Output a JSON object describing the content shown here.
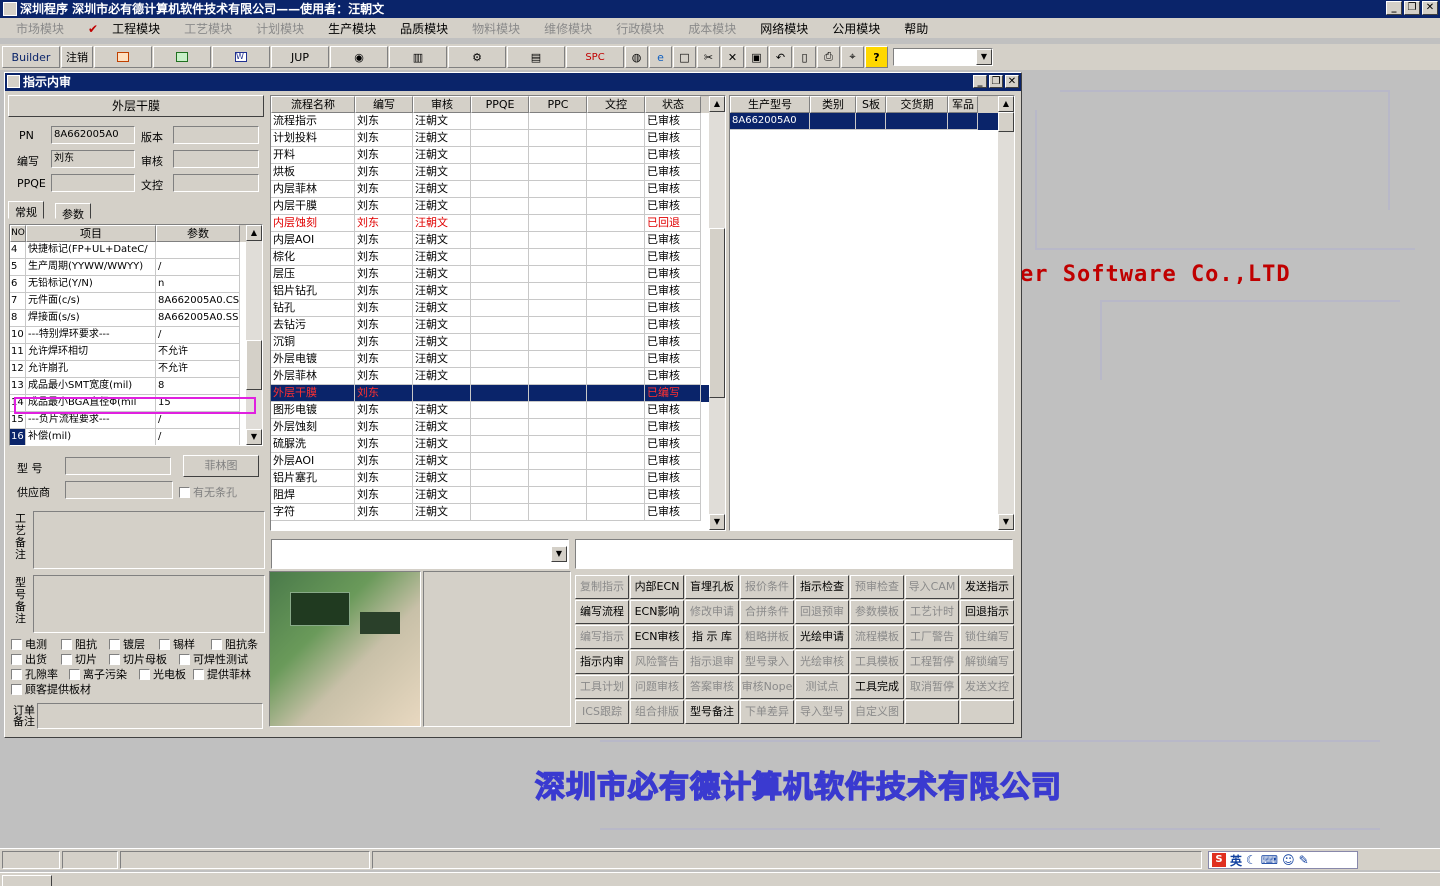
{
  "app_title": "深圳程序  深圳市必有德计算机软件技术有限公司——使用者：汪朝文",
  "window_buttons": [
    "_",
    "❐",
    "✕"
  ],
  "menu": [
    {
      "label": "市场模块",
      "enabled": false
    },
    {
      "label": "工程模块",
      "enabled": true,
      "checked": true
    },
    {
      "label": "工艺模块",
      "enabled": false
    },
    {
      "label": "计划模块",
      "enabled": false
    },
    {
      "label": "生产模块",
      "enabled": true
    },
    {
      "label": "品质模块",
      "enabled": true
    },
    {
      "label": "物料模块",
      "enabled": false
    },
    {
      "label": "维修模块",
      "enabled": false
    },
    {
      "label": "行政模块",
      "enabled": false
    },
    {
      "label": "成本模块",
      "enabled": false
    },
    {
      "label": "网络模块",
      "enabled": true
    },
    {
      "label": "公用模块",
      "enabled": true
    },
    {
      "label": "帮助",
      "enabled": true
    }
  ],
  "toolbar": {
    "builder": "Builder",
    "logout": "注销",
    "jup": "JUP",
    "spc": "SPC"
  },
  "toolbar_icons": [
    "excel-icon",
    "excel2-icon",
    "word-icon",
    "eye-icon",
    "database-icon",
    "gear-icon",
    "scanner-icon",
    "globe-icon",
    "ie-icon",
    "new-doc-icon",
    "cut-icon",
    "delete-icon",
    "save-icon",
    "undo-icon",
    "preview-icon",
    "print-icon",
    "binoculars-icon",
    "help-icon"
  ],
  "bg_text": "er Software Co.,LTD",
  "bg_banner": "深圳市必有德计算机软件技术有限公司",
  "child": {
    "title": "指示内审",
    "layer_label": "外层干膜",
    "pn_label": "PN",
    "pn_value": "8A662005A0",
    "version_label": "版本",
    "version_value": "",
    "writer_label": "编写",
    "writer_value": "刘东",
    "audit_label": "审核",
    "audit_value": "",
    "ppqe_label": "PPQE",
    "ppqe_value": "",
    "doc_label": "文控",
    "doc_value": "",
    "tabs": [
      "常规",
      "参数"
    ],
    "param_headers": [
      "NO",
      "项目",
      "参数"
    ],
    "params": [
      {
        "no": "4",
        "item": "快捷标记(FP+UL+DateC/",
        "value": ""
      },
      {
        "no": "5",
        "item": "生产周期(YYWW/WWYY)",
        "value": "/"
      },
      {
        "no": "6",
        "item": "无铅标记(Y/N)",
        "value": "n"
      },
      {
        "no": "7",
        "item": "元件面(c/s)",
        "value": "8A662005A0.CS"
      },
      {
        "no": "8",
        "item": "焊接面(s/s)",
        "value": "8A662005A0.SS"
      },
      {
        "no": "10",
        "item": "---特别焊环要求---",
        "value": "/"
      },
      {
        "no": "11",
        "item": "允许焊环相切",
        "value": "不允许"
      },
      {
        "no": "12",
        "item": "允许崩孔",
        "value": "不允许"
      },
      {
        "no": "13",
        "item": "成品最小SMT宽度(mil)",
        "value": "8"
      },
      {
        "no": "14",
        "item": "成品最小BGA直径Φ(mil",
        "value": "15"
      },
      {
        "no": "15",
        "item": "---负片流程要求---",
        "value": "/"
      },
      {
        "no": "16",
        "item": "补偿(mil)",
        "value": "/"
      }
    ],
    "model_label": "型  号",
    "model_value": "",
    "film_button": "菲林图",
    "supplier_label": "供应商",
    "supplier_value": "",
    "no_strip_label": "有无条孔",
    "process_note_label": "工艺备注",
    "model_note_label": "型号备注",
    "order_note_label": "订单备注",
    "checkboxes": [
      [
        "电测",
        "阻抗",
        "镀层",
        "锡样",
        "阻抗条"
      ],
      [
        "出货",
        "切片",
        "切片母板",
        "可焊性测试"
      ],
      [
        "孔隙率",
        "离子污染",
        "光电板",
        "提供菲林"
      ],
      [
        "顾客提供板材"
      ]
    ],
    "flow_headers": [
      "流程名称",
      "编写",
      "审核",
      "PPQE",
      "PPC",
      "文控",
      "状态"
    ],
    "flows": [
      {
        "name": "流程指示",
        "writer": "刘东",
        "auditor": "汪朝文",
        "status": "已审核"
      },
      {
        "name": "计划投料",
        "writer": "刘东",
        "auditor": "汪朝文",
        "status": "已审核"
      },
      {
        "name": "开料",
        "writer": "刘东",
        "auditor": "汪朝文",
        "status": "已审核"
      },
      {
        "name": "烘板",
        "writer": "刘东",
        "auditor": "汪朝文",
        "status": "已审核"
      },
      {
        "name": "内层菲林",
        "writer": "刘东",
        "auditor": "汪朝文",
        "status": "已审核"
      },
      {
        "name": "内层干膜",
        "writer": "刘东",
        "auditor": "汪朝文",
        "status": "已审核"
      },
      {
        "name": "内层蚀刻",
        "writer": "刘东",
        "auditor": "汪朝文",
        "status": "已回退"
      },
      {
        "name": "内层AOI",
        "writer": "刘东",
        "auditor": "汪朝文",
        "status": "已审核"
      },
      {
        "name": "棕化",
        "writer": "刘东",
        "auditor": "汪朝文",
        "status": "已审核"
      },
      {
        "name": "层压",
        "writer": "刘东",
        "auditor": "汪朝文",
        "status": "已审核"
      },
      {
        "name": "铝片钻孔",
        "writer": "刘东",
        "auditor": "汪朝文",
        "status": "已审核"
      },
      {
        "name": "钻孔",
        "writer": "刘东",
        "auditor": "汪朝文",
        "status": "已审核"
      },
      {
        "name": "去钻污",
        "writer": "刘东",
        "auditor": "汪朝文",
        "status": "已审核"
      },
      {
        "name": "沉铜",
        "writer": "刘东",
        "auditor": "汪朝文",
        "status": "已审核"
      },
      {
        "name": "外层电镀",
        "writer": "刘东",
        "auditor": "汪朝文",
        "status": "已审核"
      },
      {
        "name": "外层菲林",
        "writer": "刘东",
        "auditor": "汪朝文",
        "status": "已审核"
      },
      {
        "name": "外层干膜",
        "writer": "刘东",
        "auditor": "",
        "status": "已编写"
      },
      {
        "name": "图形电镀",
        "writer": "刘东",
        "auditor": "汪朝文",
        "status": "已审核"
      },
      {
        "name": "外层蚀刻",
        "writer": "刘东",
        "auditor": "汪朝文",
        "status": "已审核"
      },
      {
        "name": "硫脲洗",
        "writer": "刘东",
        "auditor": "汪朝文",
        "status": "已审核"
      },
      {
        "name": "外层AOI",
        "writer": "刘东",
        "auditor": "汪朝文",
        "status": "已审核"
      },
      {
        "name": "铝片塞孔",
        "writer": "刘东",
        "auditor": "汪朝文",
        "status": "已审核"
      },
      {
        "name": "阻焊",
        "writer": "刘东",
        "auditor": "汪朝文",
        "status": "已审核"
      },
      {
        "name": "字符",
        "writer": "刘东",
        "auditor": "汪朝文",
        "status": "已审核"
      }
    ],
    "prod_headers": [
      "生产型号",
      "类别",
      "S板",
      "交货期",
      "军品"
    ],
    "prod_rows": [
      [
        "8A662005A0",
        "",
        "",
        "",
        ""
      ]
    ],
    "action_buttons": [
      [
        "复制指示",
        "内部ECN",
        "盲埋孔板",
        "报价条件",
        "指示检查",
        "预审检查",
        "导入CAM",
        "发送指示"
      ],
      [
        "编写流程",
        "ECN影响",
        "修改申请",
        "合拼条件",
        "回退预审",
        "参数模板",
        "工艺计时",
        "回退指示"
      ],
      [
        "编写指示",
        "ECN审核",
        "指 示 库",
        "粗略拼板",
        "光绘申请",
        "流程模板",
        "工厂警告",
        "锁住编写"
      ],
      [
        "指示内审",
        "风险警告",
        "指示退审",
        "型号录入",
        "光绘审核",
        "工具模板",
        "工程暂停",
        "解锁编写"
      ],
      [
        "工具计划",
        "问题审核",
        "答案审核",
        "审核Nope",
        "测试点",
        "工具完成",
        "取消暂停",
        "发送文控"
      ],
      [
        "ICS跟踪",
        "组合排版",
        "型号备注",
        "下单差异",
        "导入型号",
        "自定义图",
        "",
        ""
      ]
    ],
    "action_enabled": [
      [
        false,
        true,
        true,
        false,
        true,
        false,
        false,
        true
      ],
      [
        true,
        true,
        false,
        false,
        false,
        false,
        false,
        true
      ],
      [
        false,
        true,
        true,
        false,
        true,
        false,
        false,
        false
      ],
      [
        true,
        false,
        false,
        false,
        false,
        false,
        false,
        false
      ],
      [
        false,
        false,
        false,
        false,
        false,
        true,
        false,
        false
      ],
      [
        false,
        false,
        true,
        false,
        false,
        false,
        false,
        false
      ]
    ]
  },
  "tray": {
    "ime": "英"
  }
}
